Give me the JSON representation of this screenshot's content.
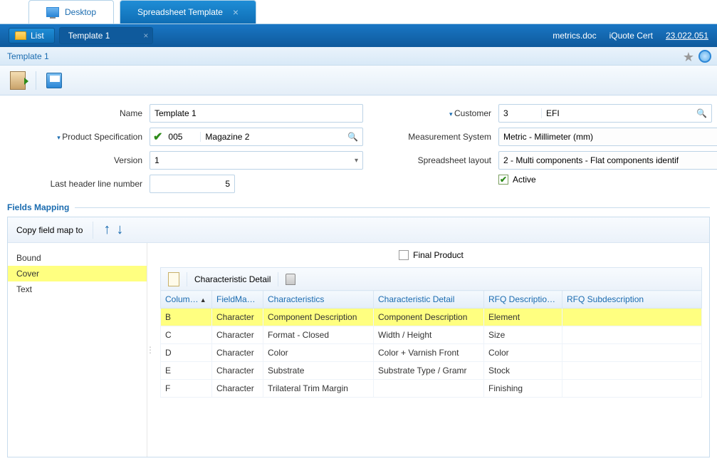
{
  "tabs": {
    "desktop": "Desktop",
    "spreadsheet": "Spreadsheet Template"
  },
  "subbar": {
    "list": "List",
    "template_tag": "Template 1",
    "links": {
      "metrics": "metrics.doc",
      "iquote": "iQuote Cert",
      "version": "23.022.051"
    }
  },
  "breadcrumb": "Template 1",
  "form": {
    "labels": {
      "name": "Name",
      "product_spec": "Product Specification",
      "version": "Version",
      "last_header": "Last header line number",
      "customer": "Customer",
      "measurement": "Measurement System",
      "layout": "Spreadsheet layout",
      "active": "Active"
    },
    "values": {
      "name": "Template 1",
      "product_spec_code": "005",
      "product_spec_name": "Magazine 2",
      "version": "1",
      "last_header": "5",
      "customer_code": "3",
      "customer_name": "EFI",
      "measurement": "Metric - Millimeter (mm)",
      "layout": "2 - Multi components - Flat components identif",
      "active": true
    }
  },
  "mapping": {
    "title": "Fields Mapping",
    "copy_label": "Copy field map to",
    "side_items": [
      "Bound",
      "Cover",
      "Text"
    ],
    "side_selected": 1,
    "final_product": "Final Product",
    "grid_toolbar": "Characteristic Detail",
    "columns": [
      "Colum…",
      "FieldMa…",
      "Characteristics",
      "Characteristic Detail",
      "RFQ Descriptio…",
      "RFQ Subdescription"
    ],
    "rows": [
      {
        "col": "B",
        "fm": "Character",
        "char": "Component Description",
        "cd": "Component Description",
        "rfq": "Element",
        "sub": ""
      },
      {
        "col": "C",
        "fm": "Character",
        "char": "Format - Closed",
        "cd": "Width / Height",
        "rfq": "Size",
        "sub": ""
      },
      {
        "col": "D",
        "fm": "Character",
        "char": "Color",
        "cd": "Color + Varnish Front",
        "rfq": "Color",
        "sub": ""
      },
      {
        "col": "E",
        "fm": "Character",
        "char": "Substrate",
        "cd": "Substrate Type / Gramr",
        "rfq": "Stock",
        "sub": ""
      },
      {
        "col": "F",
        "fm": "Character",
        "char": "Trilateral Trim Margin",
        "cd": "",
        "rfq": "Finishing",
        "sub": ""
      }
    ],
    "selected_row": 0
  }
}
